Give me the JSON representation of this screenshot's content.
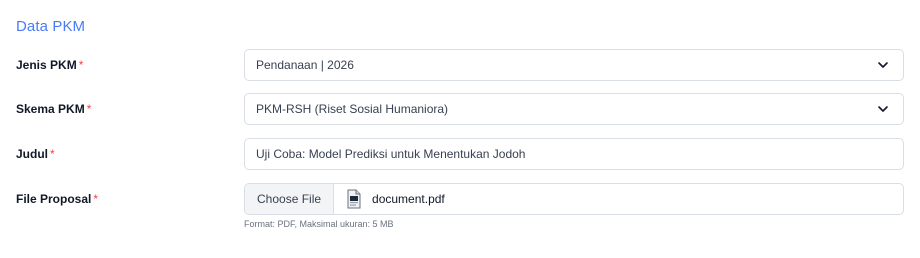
{
  "section": {
    "title": "Data PKM"
  },
  "fields": {
    "jenis": {
      "label": "Jenis PKM",
      "required_mark": "*",
      "value": "Pendanaan | 2026"
    },
    "skema": {
      "label": "Skema PKM",
      "required_mark": "*",
      "value": "PKM-RSH (Riset Sosial Humaniora)"
    },
    "judul": {
      "label": "Judul",
      "required_mark": "*",
      "value": "Uji Coba: Model Prediksi untuk Menentukan Jodoh"
    },
    "proposal": {
      "label": "File Proposal",
      "required_mark": "*",
      "button_label": "Choose File",
      "file_name": "document.pdf",
      "hint": "Format: PDF, Maksimal ukuran: 5 MB"
    }
  },
  "icons": {
    "select": "chevron-down-icon",
    "file": "pdf-file-icon"
  },
  "colors": {
    "accent": "#4a7bf7",
    "required": "#ef4444",
    "border": "#d9dee6",
    "button_bg": "#f3f4f6"
  }
}
